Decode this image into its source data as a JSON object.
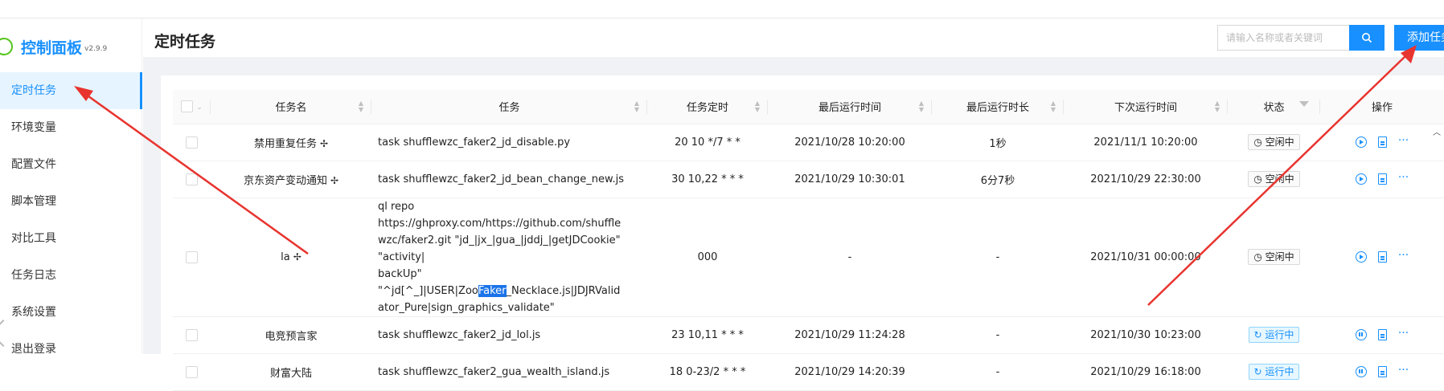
{
  "sidebar": {
    "brand": "控制面板",
    "version": "v2.9.9",
    "items": [
      {
        "label": "定时任务",
        "active": true
      },
      {
        "label": "环境变量"
      },
      {
        "label": "配置文件"
      },
      {
        "label": "脚本管理"
      },
      {
        "label": "对比工具"
      },
      {
        "label": "任务日志"
      },
      {
        "label": "系统设置"
      },
      {
        "label": "退出登录"
      }
    ]
  },
  "header": {
    "title": "定时任务",
    "search_placeholder": "请输入名称或者关键词",
    "search_icon": "search-icon",
    "add_label": "添加任务"
  },
  "table": {
    "columns": [
      "任务名",
      "任务",
      "任务定时",
      "最后运行时间",
      "最后运行时长",
      "下次运行时间",
      "状态",
      "操作"
    ],
    "rows": [
      {
        "name": "禁用重复任务",
        "pinned": true,
        "task": "task shufflewzc_faker2_jd_disable.py",
        "cron": "20 10 */7 * *",
        "last_run": "2021/10/28 10:20:00",
        "duration": "1秒",
        "next_run": "2021/11/1 10:20:00",
        "status": "空闲中",
        "running": false
      },
      {
        "name": "京东资产变动通知",
        "pinned": true,
        "task": "task shufflewzc_faker2_jd_bean_change_new.js",
        "cron": "30 10,22 * * *",
        "last_run": "2021/10/29 10:30:01",
        "duration": "6分7秒",
        "next_run": "2021/10/29 22:30:00",
        "status": "空闲中",
        "running": false
      },
      {
        "name": "la",
        "pinned": true,
        "task_lines": [
          "ql repo https://ghproxy.com/https://github.com/shuffle",
          "wzc/faker2.git \"jd_|jx_|gua_|jddj_|getJDCookie\" \"activity|",
          "backUp\" \"^jd[^_]|USER|Zoo",
          "Faker",
          "_Necklace.js|JDJRValid",
          "ator_Pure|sign_graphics_validate\""
        ],
        "cron": "000",
        "last_run": "-",
        "duration": "-",
        "next_run": "2021/10/31 00:00:00",
        "status": "空闲中",
        "running": false
      },
      {
        "name": "电竞预言家",
        "pinned": false,
        "task": "task shufflewzc_faker2_jd_lol.js",
        "cron": "23 10,11 * * *",
        "last_run": "2021/10/29 11:24:28",
        "duration": "-",
        "next_run": "2021/10/30 10:23:00",
        "status": "运行中",
        "running": true
      },
      {
        "name": "财富大陆",
        "pinned": false,
        "task": "task shufflewzc_faker2_gua_wealth_island.js",
        "cron": "18 0-23/2 * * *",
        "last_run": "2021/10/29 14:20:39",
        "duration": "-",
        "next_run": "2021/10/29 16:18:00",
        "status": "运行中",
        "running": true
      }
    ]
  },
  "colors": {
    "accent": "#1890ff",
    "annotation": "#e8342f"
  }
}
